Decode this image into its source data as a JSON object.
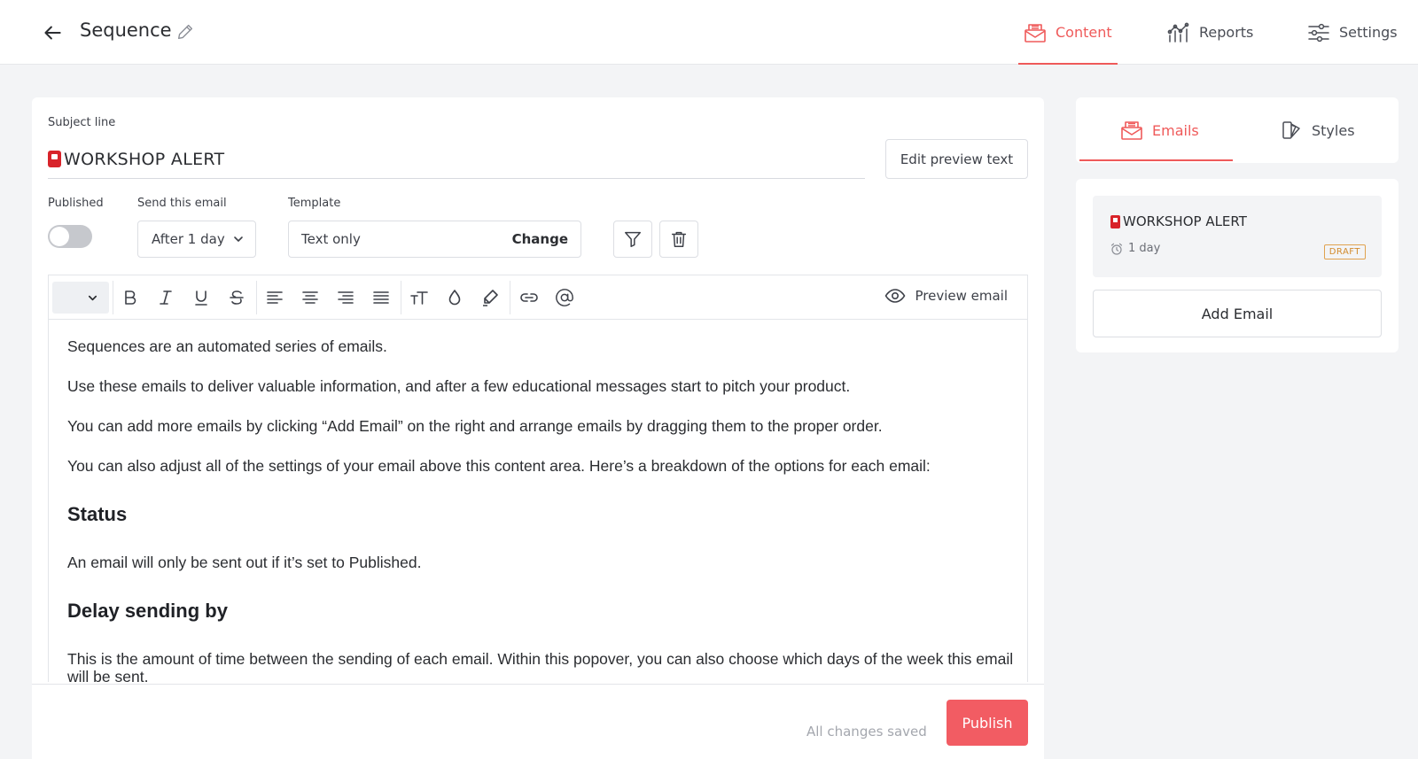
{
  "header": {
    "title": "Sequence",
    "tabs": [
      {
        "label": "Content",
        "icon": "envelope-open-icon",
        "active": true
      },
      {
        "label": "Reports",
        "icon": "reports-chart-icon",
        "active": false
      },
      {
        "label": "Settings",
        "icon": "sliders-icon",
        "active": false
      }
    ]
  },
  "email_form": {
    "subject_label": "Subject line",
    "subject_value": "WORKSHOP ALERT",
    "edit_preview_label": "Edit preview text",
    "published_label": "Published",
    "published": false,
    "send_label": "Send this email",
    "send_value": "After 1 day",
    "template_label": "Template",
    "template_value": "Text only",
    "template_change": "Change"
  },
  "editor": {
    "preview_label": "Preview email",
    "paragraphs": [
      "Sequences are an automated series of emails.",
      "Use these emails to deliver valuable information, and after a few educational messages start to pitch your product.",
      "You can add more emails by clicking “Add Email” on the right and arrange emails by dragging them to the proper order.",
      "You can also adjust all of the settings of your email above this content area. Here’s a breakdown of the options for each email:"
    ],
    "heading_status": "Status",
    "status_text": "An email will only be sent out if it’s set to Published.",
    "heading_delay": "Delay sending by",
    "delay_text": "This is the amount of time between the sending of each email. Within this popover, you can also choose which days of the week this email will be sent."
  },
  "footer": {
    "saved_text": "All changes saved",
    "publish_label": "Publish"
  },
  "sidebar": {
    "tabs": [
      {
        "label": "Emails",
        "active": true
      },
      {
        "label": "Styles",
        "active": false
      }
    ],
    "emails": [
      {
        "title": "WORKSHOP ALERT",
        "delay": "1 day",
        "status": "DRAFT"
      }
    ],
    "add_email_label": "Add Email"
  },
  "colors": {
    "accent": "#ef5a5a",
    "publish": "#f25c63",
    "draft_badge": "#d28a2c"
  }
}
